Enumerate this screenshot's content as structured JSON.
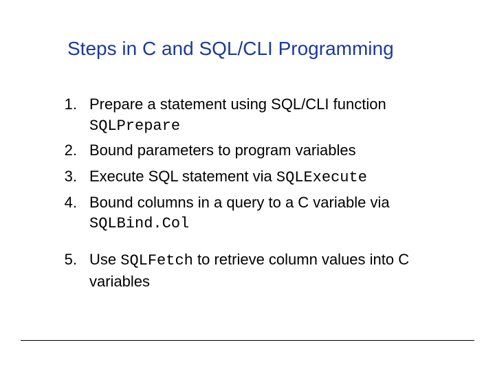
{
  "title": "Steps in C and SQL/CLI Programming",
  "items": [
    {
      "num": "1.",
      "pre": "Prepare a statement using SQL/CLI function ",
      "code": "SQLPrepare",
      "post": ""
    },
    {
      "num": "2.",
      "pre": "Bound parameters to program variables",
      "code": "",
      "post": ""
    },
    {
      "num": "3.",
      "pre": "Execute SQL statement via ",
      "code": "SQLExecute",
      "post": ""
    },
    {
      "num": "4.",
      "pre": "Bound columns in a query to a C variable via ",
      "code": "SQLBind.Col",
      "post": ""
    },
    {
      "num": "5.",
      "pre": "Use ",
      "code": "SQLFetch",
      "post": " to retrieve column values into C variables"
    }
  ]
}
